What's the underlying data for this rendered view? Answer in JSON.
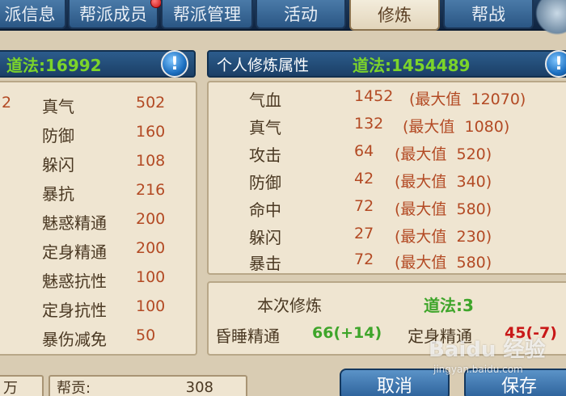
{
  "tabs": [
    {
      "label": "派信息"
    },
    {
      "label": "帮派成员"
    },
    {
      "label": "帮派管理"
    },
    {
      "label": "活动"
    },
    {
      "label": "修炼"
    },
    {
      "label": "帮战"
    }
  ],
  "left_panel": {
    "daofa_label": "道法:16992",
    "partial_value": "2",
    "stats": [
      {
        "name": "真气",
        "value": "502"
      },
      {
        "name": "防御",
        "value": "160"
      },
      {
        "name": "躲闪",
        "value": "108"
      },
      {
        "name": "暴抗",
        "value": "216"
      },
      {
        "name": "魅惑精通",
        "value": "200"
      },
      {
        "name": "定身精通",
        "value": "200"
      },
      {
        "name": "魅惑抗性",
        "value": "100"
      },
      {
        "name": "定身抗性",
        "value": "100"
      },
      {
        "name": "暴伤减免",
        "value": "50"
      }
    ]
  },
  "right_panel": {
    "title": "个人修炼属性",
    "daofa_label": "道法:1454489",
    "stats": [
      {
        "name": "气血",
        "value": "1452",
        "max": "(最大值  12070)"
      },
      {
        "name": "真气",
        "value": "132",
        "max": "(最大值  1080)"
      },
      {
        "name": "攻击",
        "value": "64",
        "max": "(最大值  520)"
      },
      {
        "name": "防御",
        "value": "42",
        "max": "(最大值  340)"
      },
      {
        "name": "命中",
        "value": "72",
        "max": "(最大值  580)"
      },
      {
        "name": "躲闪",
        "value": "27",
        "max": "(最大值  230)"
      },
      {
        "name": "暴击",
        "value": "72",
        "max": "(最大值  580)"
      }
    ]
  },
  "training": {
    "title": "本次修炼",
    "daofa_label": "道法:3",
    "item1_name": "昏睡精通",
    "item1_value": "66(+14)",
    "item2_name": "定身精通",
    "item2_value": "45(-7)"
  },
  "bottom": {
    "left_text": "万",
    "contribution_label": "帮贡:",
    "contribution_value": "308",
    "cancel_label": "取消",
    "save_label": "保存"
  },
  "watermark": {
    "main": "Baidu 经验",
    "sub": "jingyan.baidu.com"
  },
  "colors": {
    "tab_blue": "#2a5684",
    "header_blue": "#1b3f66",
    "panel_bg": "#efe5d1",
    "stat_value": "#b34a24",
    "daofa_green": "#7cd42a",
    "negative_red": "#c81818"
  },
  "icons": {
    "info": "exclamation-icon",
    "notification": "red-dot-icon"
  }
}
